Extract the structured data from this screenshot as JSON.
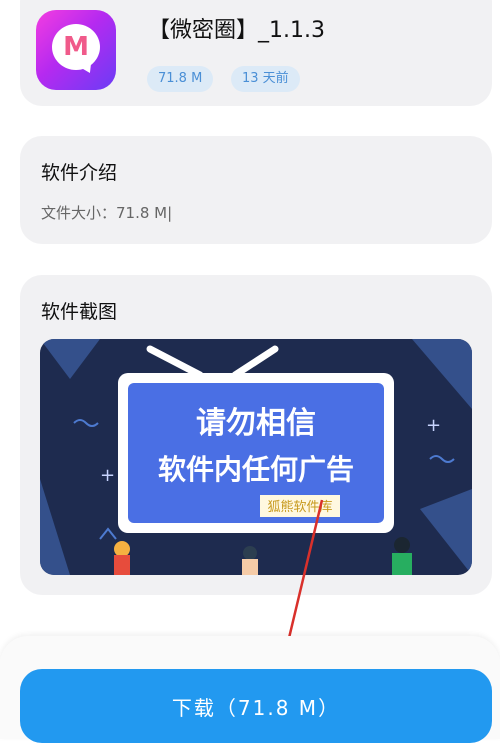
{
  "app": {
    "icon": "app-logo-m-icon",
    "title": "【微密圈】_1.1.3",
    "tags": {
      "size": "71.8 M",
      "time": "13 天前"
    }
  },
  "intro": {
    "title": "软件介绍",
    "text": "文件大小：71.8 M|"
  },
  "screenshots": {
    "title": "软件截图",
    "image": {
      "line1": "请勿相信",
      "line2": "软件内任何广告",
      "stamp": "狐熊软件库"
    }
  },
  "download": {
    "label": "下载（71.8 M）"
  },
  "colors": {
    "accent": "#2299f0",
    "tag_bg": "#dceaf7",
    "tag_text": "#4a8fd6",
    "banner_bg": "#1e2b4f",
    "banner_screen": "#4a6fe4",
    "arrow": "#d9302b"
  }
}
